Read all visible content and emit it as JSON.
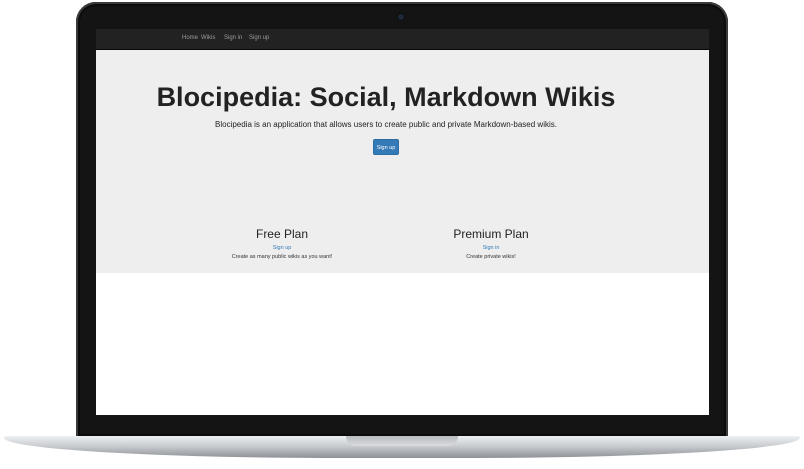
{
  "navbar": {
    "links": [
      "Home",
      "Wikis",
      "Sign in",
      "Sign up"
    ]
  },
  "hero": {
    "title": "Blocipedia: Social, Markdown Wikis",
    "description": "Blocipedia is an application that allows users to create public and private Markdown-based wikis.",
    "button_label": "Sign up",
    "button_color": "#337ab7"
  },
  "plans": [
    {
      "title": "Free Plan",
      "link_label": "Sign up",
      "description": "Create as many public wikis as you want!"
    },
    {
      "title": "Premium Plan",
      "link_label": "Sign in",
      "description": "Create private wikis!"
    }
  ],
  "colors": {
    "navbar": "#222222",
    "jumbotron": "#eeeeee",
    "link": "#337ab7"
  }
}
